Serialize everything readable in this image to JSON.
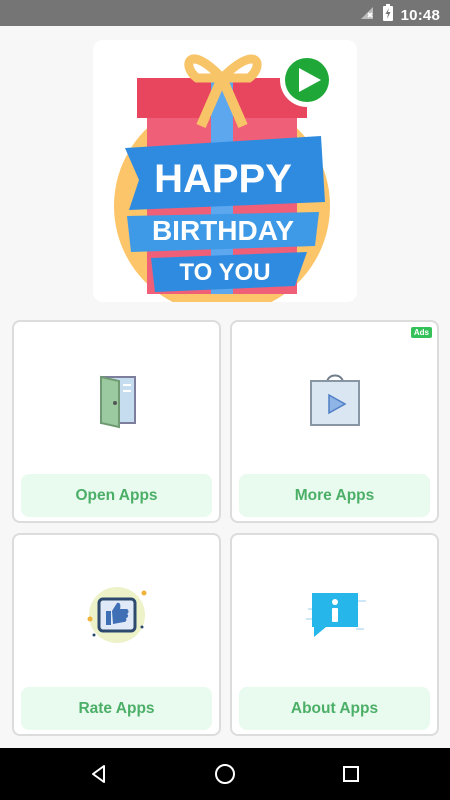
{
  "status_bar": {
    "time": "10:48"
  },
  "banner": {
    "line1": "HAPPY",
    "line2": "BIRTHDAY",
    "line3": "TO YOU"
  },
  "cards": [
    {
      "label": "Open Apps",
      "icon": "door-icon"
    },
    {
      "label": "More Apps",
      "icon": "play-store-bag-icon",
      "badge": "Ads"
    },
    {
      "label": "Rate Apps",
      "icon": "thumbs-up-icon"
    },
    {
      "label": "About Apps",
      "icon": "info-icon"
    }
  ],
  "nav": {
    "back": "back-icon",
    "home": "home-icon",
    "recents": "recents-icon"
  },
  "colors": {
    "accent_green": "#4caf68",
    "label_bg": "#e9faee",
    "ads_green": "#34c159",
    "status_bar": "#757575"
  }
}
